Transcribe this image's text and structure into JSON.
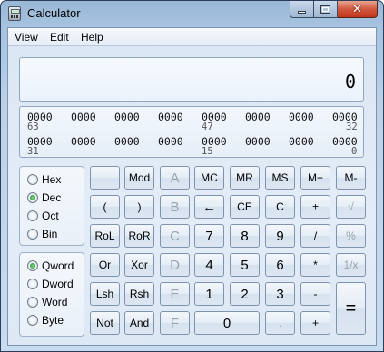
{
  "window": {
    "title": "Calculator"
  },
  "menu": {
    "view": "View",
    "edit": "Edit",
    "help": "Help"
  },
  "display": {
    "value": "0"
  },
  "binary": {
    "row1": [
      "0000",
      "0000",
      "0000",
      "0000",
      "0000",
      "0000",
      "0000",
      "0000"
    ],
    "row1_positions": [
      "63",
      "47",
      "32"
    ],
    "row2": [
      "0000",
      "0000",
      "0000",
      "0000",
      "0000",
      "0000",
      "0000",
      "0000"
    ],
    "row2_positions": [
      "31",
      "15",
      "0"
    ]
  },
  "base": {
    "options": [
      "Hex",
      "Dec",
      "Oct",
      "Bin"
    ],
    "selected": "Dec"
  },
  "word": {
    "options": [
      "Qword",
      "Dword",
      "Word",
      "Byte"
    ],
    "selected": "Qword"
  },
  "keys": {
    "r1": [
      "",
      "Mod",
      "A",
      "MC",
      "MR",
      "MS",
      "M+",
      "M-"
    ],
    "r2": [
      "(",
      ")",
      "B",
      "←",
      "CE",
      "C",
      "±",
      "√"
    ],
    "r3": [
      "RoL",
      "RoR",
      "C",
      "7",
      "8",
      "9",
      "/",
      "%"
    ],
    "r4": [
      "Or",
      "Xor",
      "D",
      "4",
      "5",
      "6",
      "*",
      "1/x"
    ],
    "r5": [
      "Lsh",
      "Rsh",
      "E",
      "1",
      "2",
      "3",
      "-",
      "="
    ],
    "r6": [
      "Not",
      "And",
      "F",
      "0",
      ".",
      "+"
    ]
  }
}
